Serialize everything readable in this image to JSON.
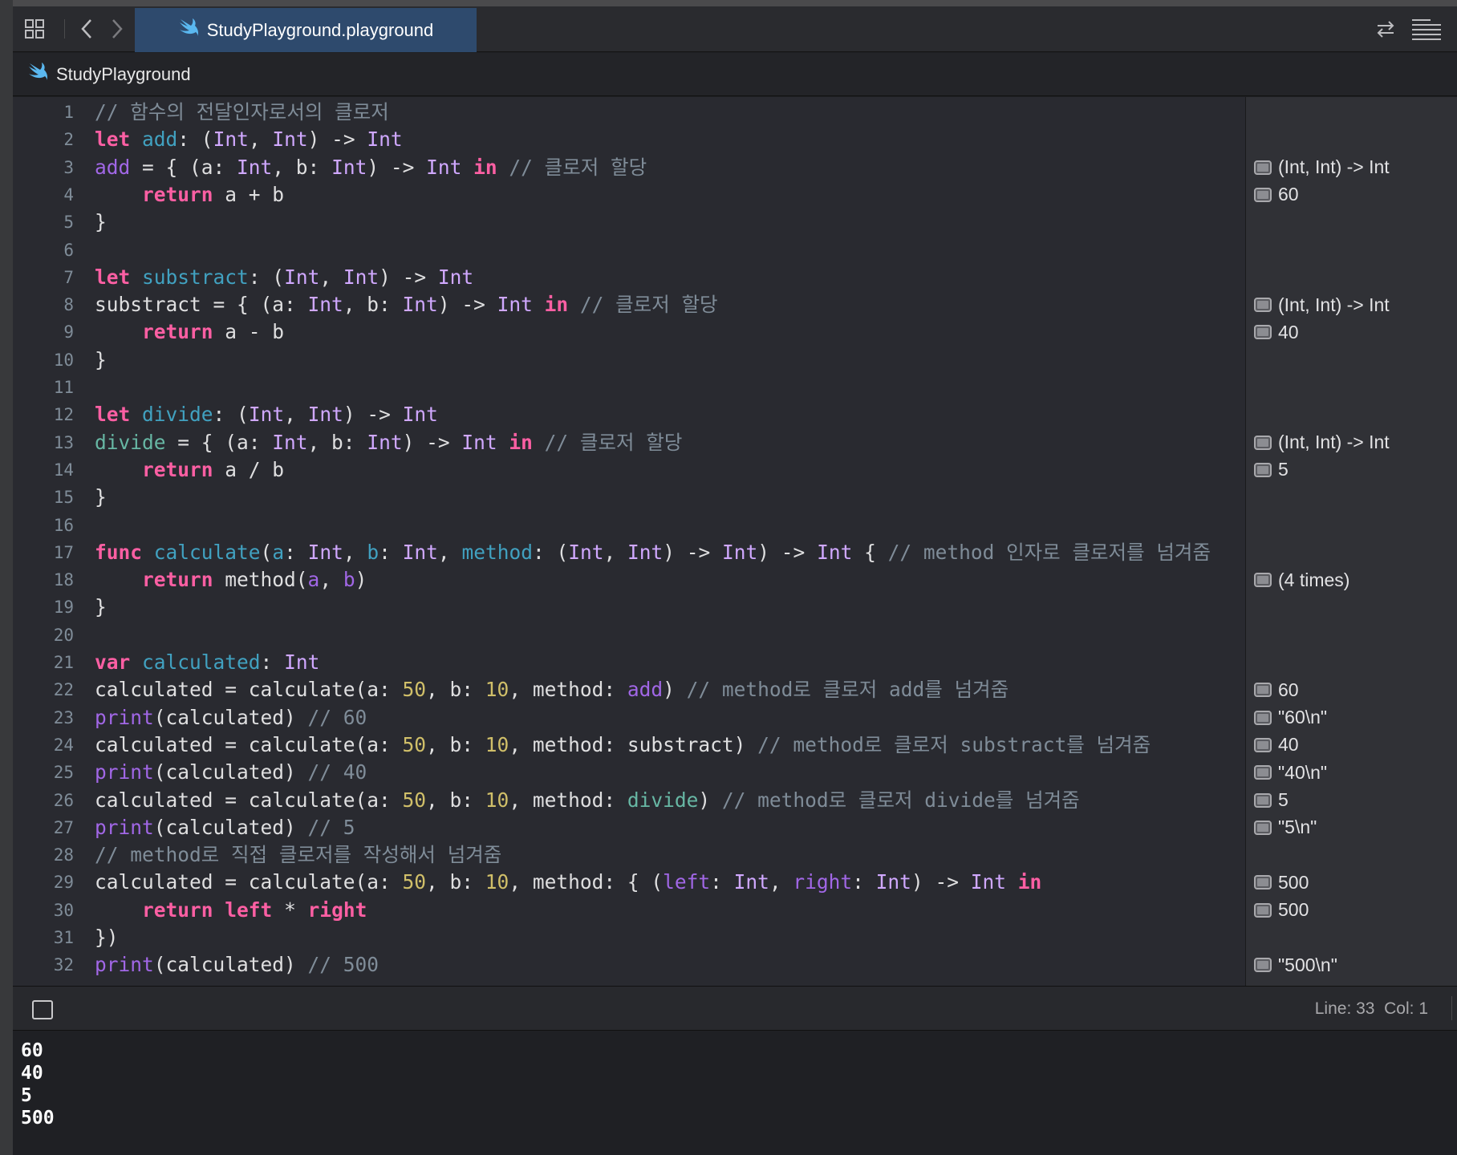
{
  "window": {
    "tab_title": "StudyPlayground.playground",
    "breadcrumb": "StudyPlayground",
    "icons": {
      "grid": "grid-icon",
      "back": "chevron-left-icon",
      "forward": "chevron-right-icon",
      "swift": "swift-icon",
      "sync": "arrows-swap-icon",
      "editor_options": "lines-icon"
    }
  },
  "code_lines": [
    {
      "num": "1",
      "html": "<span class=\"cm\">// 함수의 전달인자로서의 클로저</span>"
    },
    {
      "num": "2",
      "html": "<span class=\"kw\">let</span> <span class=\"dc\">add</span>: (<span class=\"ty\">Int</span>, <span class=\"ty\">Int</span>) -&gt; <span class=\"ty\">Int</span>"
    },
    {
      "num": "3",
      "html": "<span class=\"pu\">add</span> = { (a: <span class=\"ty\">Int</span>, b: <span class=\"ty\">Int</span>) -&gt; <span class=\"ty\">Int</span> <span class=\"kw\">in</span> <span class=\"cm\">// 클로저 할당</span>"
    },
    {
      "num": "4",
      "html": "    <span class=\"kw\">return</span> a + b"
    },
    {
      "num": "5",
      "html": "}"
    },
    {
      "num": "6",
      "html": ""
    },
    {
      "num": "7",
      "html": "<span class=\"kw\">let</span> <span class=\"dc\">substract</span>: (<span class=\"ty\">Int</span>, <span class=\"ty\">Int</span>) -&gt; <span class=\"ty\">Int</span>"
    },
    {
      "num": "8",
      "html": "substract = { (a: <span class=\"ty\">Int</span>, b: <span class=\"ty\">Int</span>) -&gt; <span class=\"ty\">Int</span> <span class=\"kw\">in</span> <span class=\"cm\">// 클로저 할당</span>"
    },
    {
      "num": "9",
      "html": "    <span class=\"kw\">return</span> a - b"
    },
    {
      "num": "10",
      "html": "}"
    },
    {
      "num": "11",
      "html": ""
    },
    {
      "num": "12",
      "html": "<span class=\"kw\">let</span> <span class=\"dc\">divide</span>: (<span class=\"ty\">Int</span>, <span class=\"ty\">Int</span>) -&gt; <span class=\"ty\">Int</span>"
    },
    {
      "num": "13",
      "html": "<span class=\"pr\">divide</span> = { (a: <span class=\"ty\">Int</span>, b: <span class=\"ty\">Int</span>) -&gt; <span class=\"ty\">Int</span> <span class=\"kw\">in</span> <span class=\"cm\">// 클로저 할당</span>"
    },
    {
      "num": "14",
      "html": "    <span class=\"kw\">return</span> a / b"
    },
    {
      "num": "15",
      "html": "}"
    },
    {
      "num": "16",
      "html": ""
    },
    {
      "num": "17",
      "html": "<span class=\"kw\">func</span> <span class=\"dc\">calculate</span>(<span class=\"dc\">a</span>: <span class=\"ty\">Int</span>, <span class=\"dc\">b</span>: <span class=\"ty\">Int</span>, <span class=\"dc\">method</span>: (<span class=\"ty\">Int</span>, <span class=\"ty\">Int</span>) -&gt; <span class=\"ty\">Int</span>) -&gt; <span class=\"ty\">Int</span> { <span class=\"cm\">// method 인자로 클로저를 넘겨줌</span>"
    },
    {
      "num": "18",
      "html": "    <span class=\"kw\">return</span> method(<span class=\"pu\">a</span>, <span class=\"pu\">b</span>)"
    },
    {
      "num": "19",
      "html": "}"
    },
    {
      "num": "20",
      "html": ""
    },
    {
      "num": "21",
      "html": "<span class=\"kw\">var</span> <span class=\"dc\">calculated</span>: <span class=\"ty\">Int</span>"
    },
    {
      "num": "22",
      "html": "calculated = calculate(a: <span class=\"nm\">50</span>, b: <span class=\"nm\">10</span>, method: <span class=\"pu\">add</span>) <span class=\"cm\">// method로 클로저 add를 넘겨줌</span>"
    },
    {
      "num": "23",
      "html": "<span class=\"pu\">print</span>(calculated) <span class=\"cm\">// 60</span>"
    },
    {
      "num": "24",
      "html": "calculated = calculate(a: <span class=\"nm\">50</span>, b: <span class=\"nm\">10</span>, method: substract) <span class=\"cm\">// method로 클로저 substract를 넘겨줌</span>"
    },
    {
      "num": "25",
      "html": "<span class=\"pu\">print</span>(calculated) <span class=\"cm\">// 40</span>"
    },
    {
      "num": "26",
      "html": "calculated = calculate(a: <span class=\"nm\">50</span>, b: <span class=\"nm\">10</span>, method: <span class=\"pr\">divide</span>) <span class=\"cm\">// method로 클로저 divide를 넘겨줌</span>"
    },
    {
      "num": "27",
      "html": "<span class=\"pu\">print</span>(calculated) <span class=\"cm\">// 5</span>"
    },
    {
      "num": "28",
      "html": "<span class=\"cm\">// method로 직접 클로저를 작성해서 넘겨줌</span>"
    },
    {
      "num": "29",
      "html": "calculated = calculate(a: <span class=\"nm\">50</span>, b: <span class=\"nm\">10</span>, method: { (<span class=\"pu\">left</span>: <span class=\"ty\">Int</span>, <span class=\"pu\">right</span>: <span class=\"ty\">Int</span>) -&gt; <span class=\"ty\">Int</span> <span class=\"kw\">in</span>"
    },
    {
      "num": "30",
      "html": "    <span class=\"kw\">return</span> <span class=\"kw\">left</span> * <span class=\"kw\">right</span>"
    },
    {
      "num": "31",
      "html": "})"
    },
    {
      "num": "32",
      "html": "<span class=\"pu\">print</span>(calculated) <span class=\"cm\">// 500</span>"
    }
  ],
  "results": [
    {
      "line": "3",
      "text": "(Int, Int) -> Int"
    },
    {
      "line": "4",
      "text": "60"
    },
    {
      "line": "8",
      "text": "(Int, Int) -> Int"
    },
    {
      "line": "9",
      "text": "40"
    },
    {
      "line": "13",
      "text": "(Int, Int) -> Int"
    },
    {
      "line": "14",
      "text": "5"
    },
    {
      "line": "18",
      "text": "(4 times)"
    },
    {
      "line": "22",
      "text": "60"
    },
    {
      "line": "23",
      "text": "\"60\\n\""
    },
    {
      "line": "24",
      "text": "40"
    },
    {
      "line": "25",
      "text": "\"40\\n\""
    },
    {
      "line": "26",
      "text": "5"
    },
    {
      "line": "27",
      "text": "\"5\\n\""
    },
    {
      "line": "29",
      "text": "500"
    },
    {
      "line": "30",
      "text": "500"
    },
    {
      "line": "32",
      "text": "\"500\\n\""
    }
  ],
  "status": {
    "cursor_line": "Line: 33",
    "cursor_col": "Col: 1"
  },
  "console_output": [
    "60",
    "40",
    "5",
    "500"
  ],
  "colors": {
    "keyword": "#fc5fa3",
    "type": "#d0a8ff",
    "declaration": "#41a1c0",
    "number": "#d0bf69",
    "comment": "#7f8c98",
    "tab_active": "#2e4a6d"
  }
}
